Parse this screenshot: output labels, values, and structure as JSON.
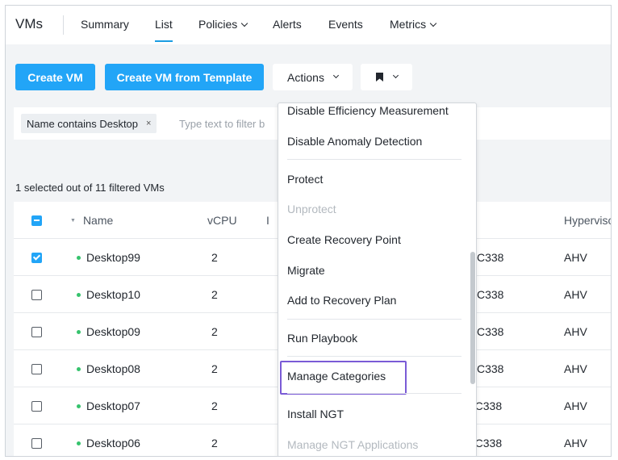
{
  "nav": {
    "title": "VMs",
    "items": [
      {
        "label": "Summary"
      },
      {
        "label": "List"
      },
      {
        "label": "Policies"
      },
      {
        "label": "Alerts"
      },
      {
        "label": "Events"
      },
      {
        "label": "Metrics"
      }
    ],
    "active": "List"
  },
  "toolbar": {
    "create_vm": "Create VM",
    "create_from_template": "Create VM from Template",
    "actions": "Actions"
  },
  "filter": {
    "chip": "Name contains Desktop",
    "chip_remove": "×",
    "placeholder": "Type text to filter b"
  },
  "selection_info": "1 selected out of 11 filtered VMs",
  "table": {
    "columns": {
      "name": "Name",
      "vcpu": "vCPU",
      "col3": "I",
      "hypervisor": "Hyperviso"
    },
    "rows": [
      {
        "name": "Desktop99",
        "vcpu": "2",
        "host": "C338",
        "hypervisor": "AHV",
        "checked": true
      },
      {
        "name": "Desktop10",
        "vcpu": "2",
        "host": "C338",
        "hypervisor": "AHV",
        "checked": false
      },
      {
        "name": "Desktop09",
        "vcpu": "2",
        "host": "C338",
        "hypervisor": "AHV",
        "checked": false
      },
      {
        "name": "Desktop08",
        "vcpu": "2",
        "host": "C338",
        "hypervisor": "AHV",
        "checked": false
      },
      {
        "name": "Desktop07",
        "vcpu": "2",
        "host": ")C338",
        "hypervisor": "AHV",
        "checked": false
      },
      {
        "name": "Desktop06",
        "vcpu": "2",
        "host": ")C338",
        "hypervisor": "AHV",
        "checked": false
      }
    ]
  },
  "actions_menu": {
    "items": [
      {
        "label": "Disable Efficiency Measurement"
      },
      {
        "label": "Disable Anomaly Detection"
      },
      {
        "label": "Protect"
      },
      {
        "label": "Unprotect",
        "disabled": true
      },
      {
        "label": "Create Recovery Point"
      },
      {
        "label": "Migrate"
      },
      {
        "label": "Add to Recovery Plan"
      },
      {
        "label": "Run Playbook"
      },
      {
        "label": "Manage Categories",
        "highlighted": true
      },
      {
        "label": "Install NGT"
      },
      {
        "label": "Manage NGT Applications",
        "disabled": true
      }
    ]
  },
  "colors": {
    "primary": "#22a5f7",
    "highlight_border": "#7a5bd6",
    "status_green": "#36c36d",
    "background_grey": "#f2f4f6"
  }
}
